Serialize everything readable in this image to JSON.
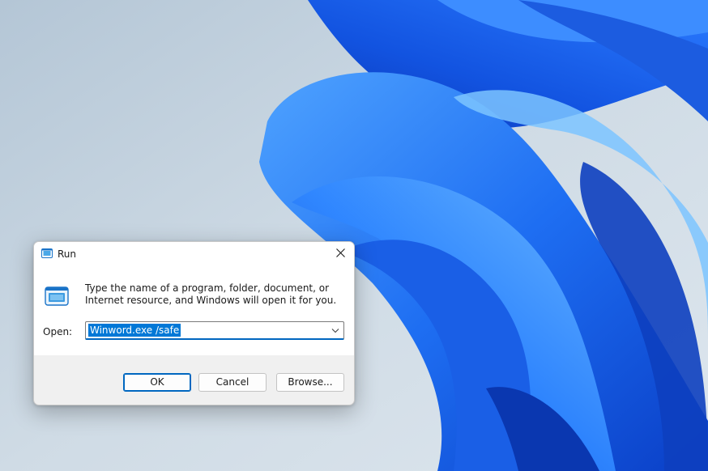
{
  "dialog": {
    "title": "Run",
    "description": "Type the name of a program, folder, document, or Internet resource, and Windows will open it for you.",
    "open_label": "Open:",
    "open_value": "Winword.exe /safe",
    "buttons": {
      "ok": "OK",
      "cancel": "Cancel",
      "browse": "Browse..."
    }
  },
  "icons": {
    "title": "run-app-icon",
    "body": "run-app-icon",
    "close": "close-icon",
    "dropdown": "chevron-down-icon"
  },
  "colors": {
    "wallpaper_bg": "#c5d3df",
    "bloom_blue": "#1f6ff0",
    "selection": "#0078d7",
    "accent": "#0067c0",
    "dialog_footer": "#f0f0f0"
  }
}
